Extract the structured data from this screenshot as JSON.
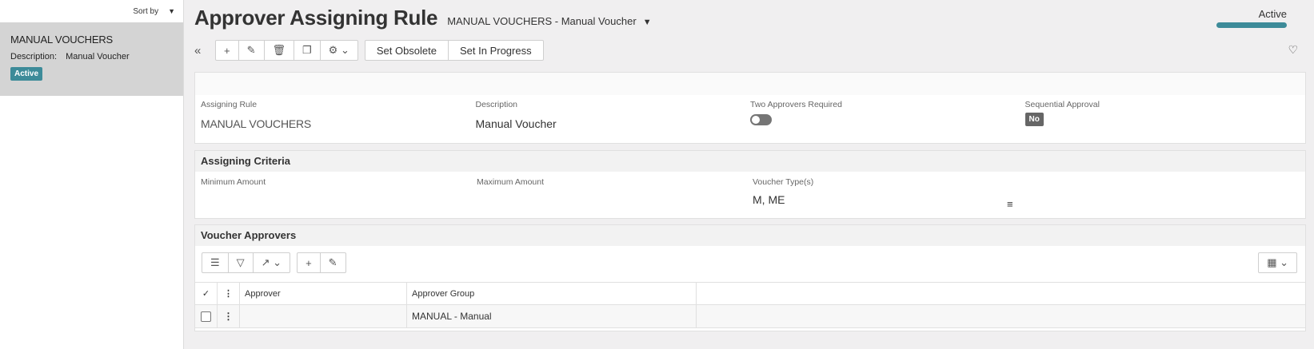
{
  "left_panel": {
    "sort_label": "Sort by",
    "record": {
      "title": "MANUAL VOUCHERS",
      "description_key": "Description:",
      "description_value": "Manual Voucher",
      "status": "Active"
    }
  },
  "header": {
    "title": "Approver Assigning Rule",
    "subtitle": "MANUAL VOUCHERS - Manual Voucher",
    "status_label": "Active"
  },
  "toolbar": {
    "set_obsolete": "Set Obsolete",
    "set_in_progress": "Set In Progress"
  },
  "main_card": {
    "assigning_rule_label": "Assigning Rule",
    "assigning_rule_value": "MANUAL VOUCHERS",
    "description_label": "Description",
    "description_value": "Manual Voucher",
    "two_approvers_label": "Two Approvers Required",
    "two_approvers_value": false,
    "sequential_label": "Sequential Approval",
    "sequential_value": "No"
  },
  "criteria": {
    "title": "Assigning Criteria",
    "min_label": "Minimum Amount",
    "max_label": "Maximum Amount",
    "voucher_types_label": "Voucher Type(s)",
    "voucher_types_value": "M, ME"
  },
  "approvers": {
    "title": "Voucher Approvers",
    "columns": [
      "Approver",
      "Approver Group"
    ],
    "rows": [
      {
        "approver": "",
        "approver_group": "MANUAL - Manual"
      }
    ]
  }
}
